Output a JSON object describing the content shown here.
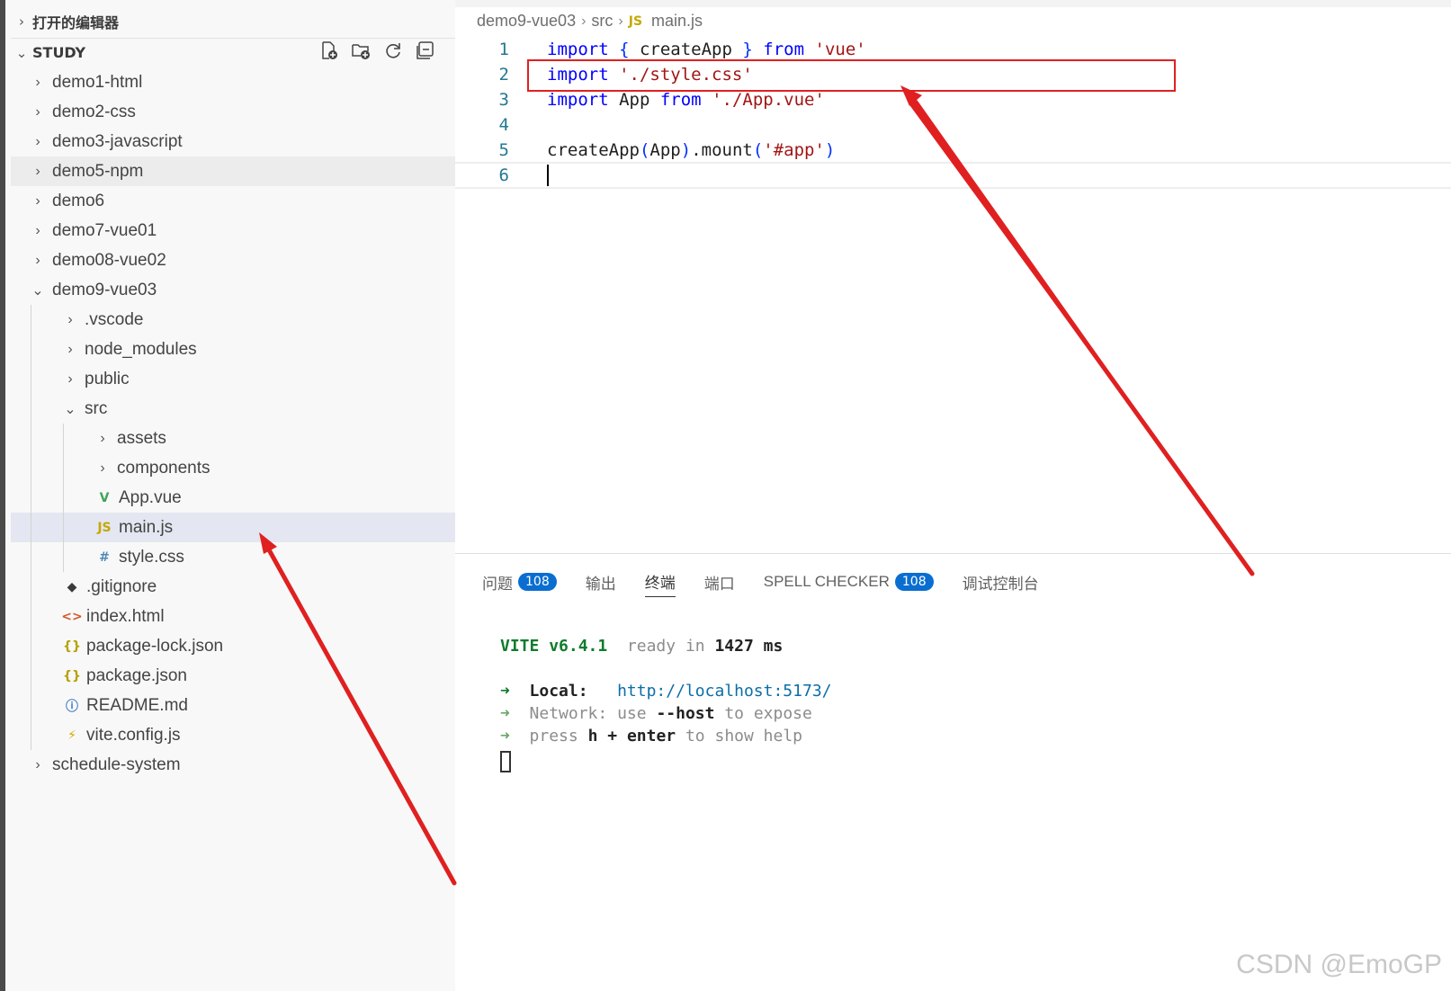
{
  "sidebar": {
    "open_editors_label": "打开的编辑器",
    "workspace_label": "STUDY",
    "actions": [
      "new-file-icon",
      "new-folder-icon",
      "refresh-icon",
      "collapse-all-icon"
    ],
    "items": [
      {
        "label": "demo1-html",
        "type": "folder",
        "expanded": false
      },
      {
        "label": "demo2-css",
        "type": "folder",
        "expanded": false
      },
      {
        "label": "demo3-javascript",
        "type": "folder",
        "expanded": false
      },
      {
        "label": "demo5-npm",
        "type": "folder",
        "expanded": false
      },
      {
        "label": "demo6",
        "type": "folder",
        "expanded": false
      },
      {
        "label": "demo7-vue01",
        "type": "folder",
        "expanded": false
      },
      {
        "label": "demo08-vue02",
        "type": "folder",
        "expanded": false
      },
      {
        "label": "demo9-vue03",
        "type": "folder",
        "expanded": true
      },
      {
        "label": ".vscode",
        "type": "folder",
        "expanded": false
      },
      {
        "label": "node_modules",
        "type": "folder",
        "expanded": false
      },
      {
        "label": "public",
        "type": "folder",
        "expanded": false
      },
      {
        "label": "src",
        "type": "folder",
        "expanded": true
      },
      {
        "label": "assets",
        "type": "folder",
        "expanded": false
      },
      {
        "label": "components",
        "type": "folder",
        "expanded": false
      },
      {
        "label": "App.vue",
        "type": "file",
        "icon": "vue-icon",
        "glyph": "V"
      },
      {
        "label": "main.js",
        "type": "file",
        "icon": "js-icon",
        "glyph": "JS"
      },
      {
        "label": "style.css",
        "type": "file",
        "icon": "css-icon",
        "glyph": "#"
      },
      {
        "label": ".gitignore",
        "type": "file",
        "icon": "git-icon",
        "glyph": "◆"
      },
      {
        "label": "index.html",
        "type": "file",
        "icon": "html-icon",
        "glyph": "<>"
      },
      {
        "label": "package-lock.json",
        "type": "file",
        "icon": "json-icon",
        "glyph": "{}"
      },
      {
        "label": "package.json",
        "type": "file",
        "icon": "json-icon",
        "glyph": "{}"
      },
      {
        "label": "README.md",
        "type": "file",
        "icon": "info-icon",
        "glyph": "ⓘ"
      },
      {
        "label": "vite.config.js",
        "type": "file",
        "icon": "vite-icon",
        "glyph": "⚡"
      },
      {
        "label": "schedule-system",
        "type": "folder",
        "expanded": false
      }
    ]
  },
  "breadcrumb": {
    "parts": [
      "demo9-vue03",
      "src"
    ],
    "file_glyph": "JS",
    "file": "main.js"
  },
  "editor": {
    "line_numbers": [
      "1",
      "2",
      "3",
      "4",
      "5",
      "6"
    ]
  },
  "panel": {
    "tabs": [
      {
        "label": "问题",
        "badge": "108"
      },
      {
        "label": "输出"
      },
      {
        "label": "终端",
        "active": true
      },
      {
        "label": "端口"
      },
      {
        "label": "SPELL CHECKER",
        "badge": "108"
      },
      {
        "label": "调试控制台"
      }
    ]
  },
  "terminal": {
    "vite": "VITE",
    "version": "v6.4.1",
    "ready": "ready in",
    "ms_value": "1427",
    "ms": "ms",
    "arrow": "➜",
    "local_label": "Local:",
    "local_url": "http://localhost:5173/",
    "network_label": "Network:",
    "network_use": "use",
    "network_flag": "--host",
    "network_rest": "to expose",
    "press": "press",
    "key_h": "h",
    "plus": "+",
    "enter": "enter",
    "help_rest": "to show help"
  },
  "watermark": "CSDN @EmoGP",
  "colors": {
    "annotation": "#e02020",
    "badge": "#0a6ed1",
    "keyword": "#0000ff",
    "string": "#a31515"
  }
}
